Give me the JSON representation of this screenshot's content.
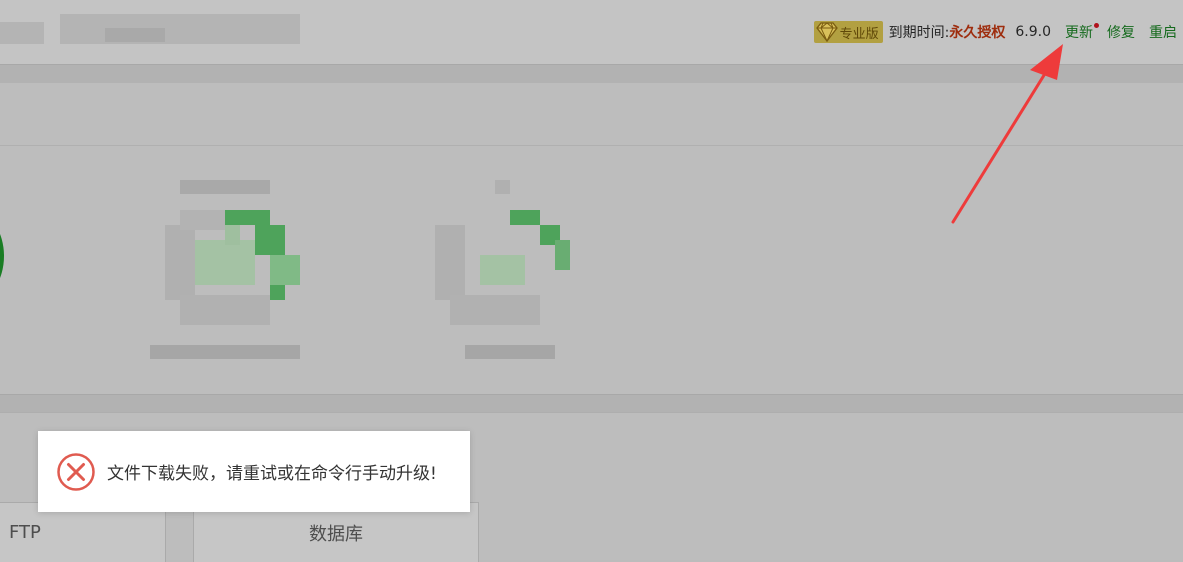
{
  "header": {
    "pro_badge_label": "专业版",
    "expire_label": "到期时间:",
    "expire_value": "永久授权",
    "version": "6.9.0",
    "update_label": "更新",
    "repair_label": "修复",
    "restart_label": "重启"
  },
  "tabs": [
    {
      "label": "FTP"
    },
    {
      "label": "数据库"
    }
  ],
  "toast": {
    "message": "文件下载失败，请重试或在命令行手动升级!",
    "icon": "error-circle-x-icon"
  },
  "colors": {
    "expire_value": "#9e2d0e",
    "link": "#156a1d",
    "error_red": "#e05b50",
    "arrow_red": "#ee3b3b",
    "status_green": "#1a7d24"
  }
}
